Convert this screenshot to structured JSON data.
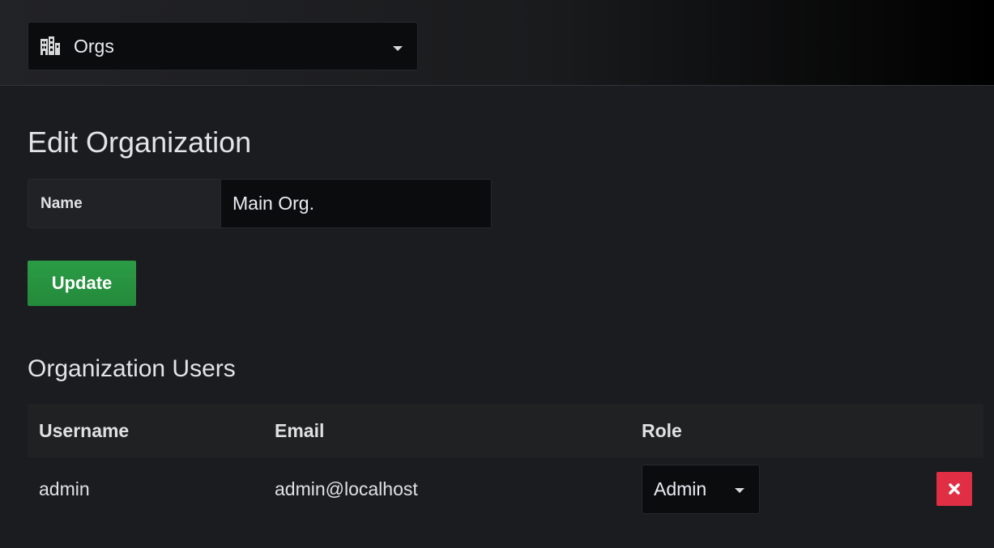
{
  "org_picker": {
    "label": "Orgs",
    "icon": "building-icon"
  },
  "page_title": "Edit Organization",
  "name_field": {
    "label": "Name",
    "value": "Main Org."
  },
  "update_button": {
    "label": "Update",
    "color": "#299c46"
  },
  "users_section": {
    "title": "Organization Users",
    "columns": [
      "Username",
      "Email",
      "Role"
    ],
    "rows": [
      {
        "username": "admin",
        "email": "admin@localhost",
        "role": "Admin"
      }
    ]
  },
  "delete_button": {
    "icon": "close-icon",
    "color": "#e02f44"
  }
}
